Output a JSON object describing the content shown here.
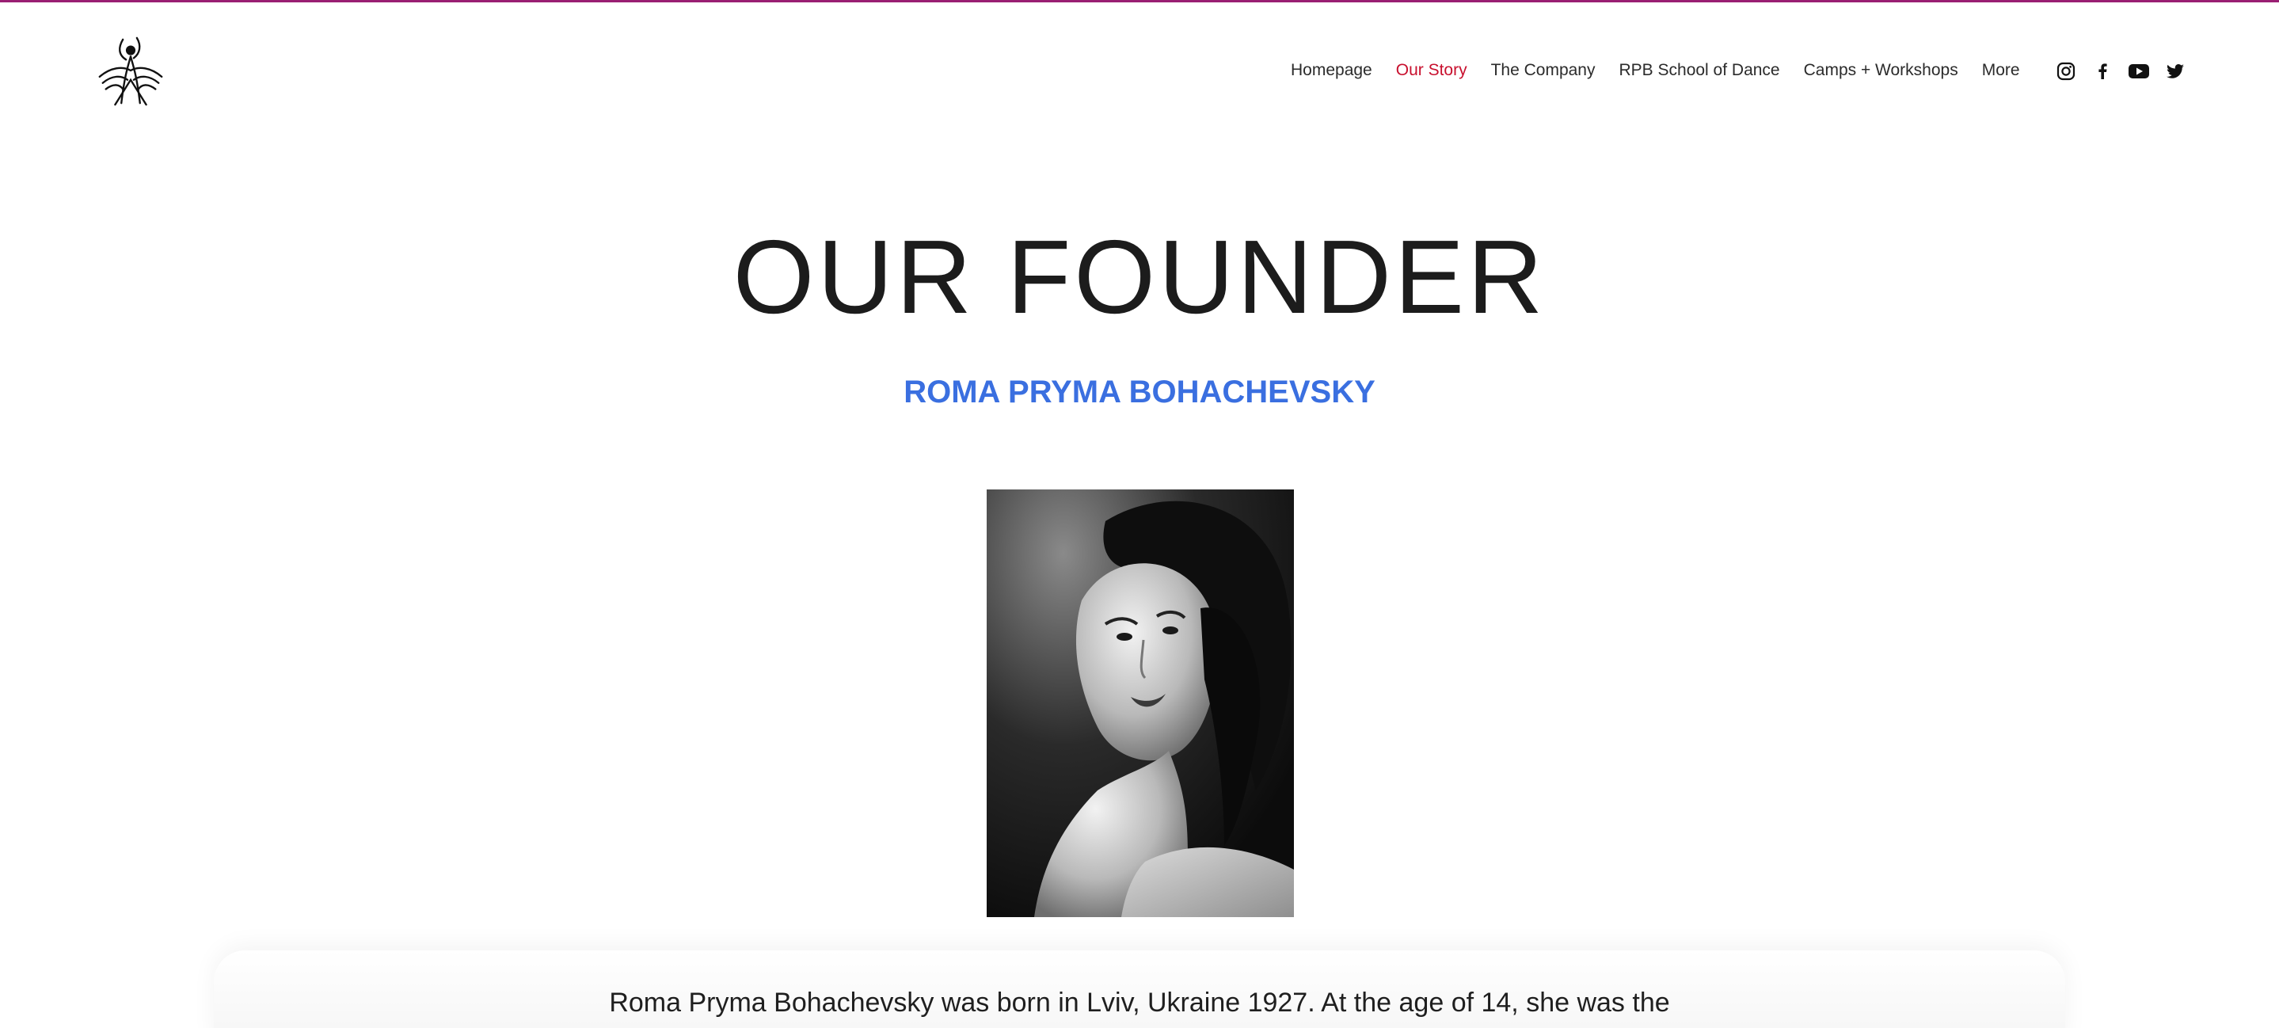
{
  "brand": {
    "logo_icon": "dancer-logo-icon",
    "accent_color": "#9a1f73"
  },
  "nav": {
    "items": [
      {
        "label": "Homepage",
        "active": false
      },
      {
        "label": "Our Story",
        "active": true
      },
      {
        "label": "The Company",
        "active": false
      },
      {
        "label": "RPB School of Dance",
        "active": false
      },
      {
        "label": "Camps + Workshops",
        "active": false
      },
      {
        "label": "More",
        "active": false
      }
    ],
    "active_color": "#c8102e"
  },
  "social": {
    "icons": [
      "instagram-icon",
      "facebook-icon",
      "youtube-icon",
      "twitter-icon"
    ]
  },
  "main": {
    "title": "OUR FOUNDER",
    "subtitle": "ROMA PRYMA BOHACHEVSKY",
    "subtitle_color": "#3a6fe0",
    "bio_first_line": "Roma Pryma Bohachevsky was born in Lviv, Ukraine 1927. At the age of 14, she was the"
  }
}
